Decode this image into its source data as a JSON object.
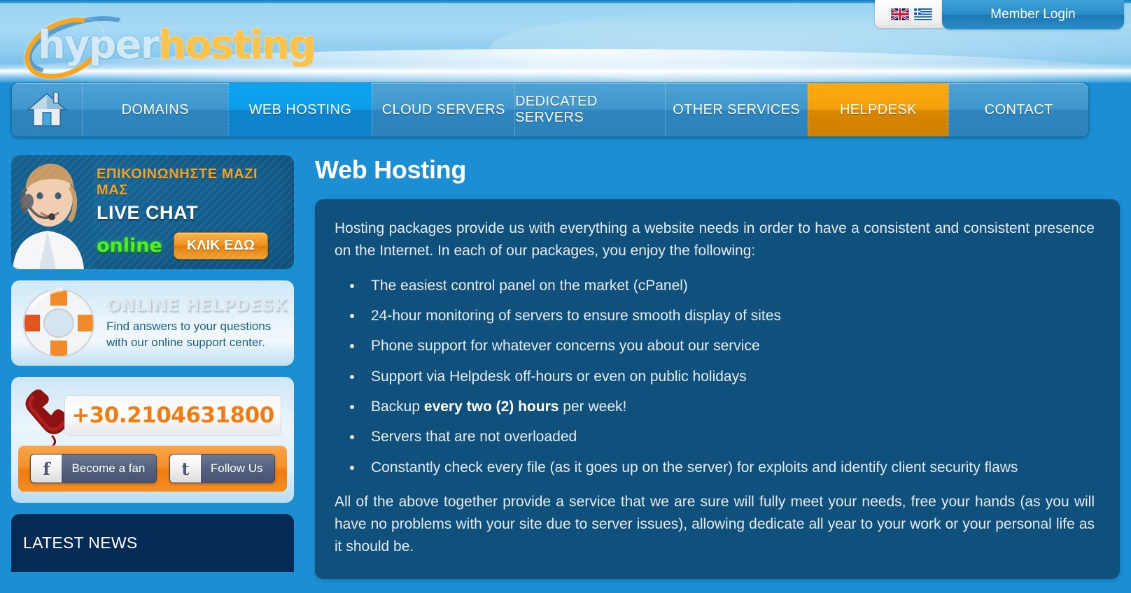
{
  "header": {
    "logo": {
      "part1": "hyper",
      "part2": "hosting"
    },
    "lang": {
      "flag_en_name": "uk-flag-icon",
      "flag_el_name": "greece-flag-icon"
    },
    "member_login": "Member Login"
  },
  "nav": {
    "home_icon": "home-icon",
    "items": [
      {
        "label": "DOMAINS",
        "state": "normal"
      },
      {
        "label": "WEB HOSTING",
        "state": "active-blue"
      },
      {
        "label": "CLOUD SERVERS",
        "state": "normal"
      },
      {
        "label": "DEDICATED SERVERS",
        "state": "normal"
      },
      {
        "label": "OTHER SERVICES",
        "state": "normal"
      },
      {
        "label": "HELPDESK",
        "state": "active-orange"
      },
      {
        "label": "CONTACT",
        "state": "normal"
      }
    ]
  },
  "sidebar": {
    "livechat": {
      "headline": "ΕΠΙΚΟΙΝΩΝΗΣΤΕ ΜΑΖΙ ΜΑΣ",
      "title": "LIVE CHAT",
      "status": "online",
      "button": "ΚΛΙΚ ΕΔΩ",
      "agent_icon": "support-agent-photo"
    },
    "helpdesk": {
      "title": "ONLINE HELPDESK",
      "description": "Find answers to your questions with our online support center.",
      "icon": "lifebuoy-icon"
    },
    "phone": {
      "number": "+30.2104631800",
      "icon": "phone-handset-icon",
      "facebook_label": "Become a fan",
      "facebook_glyph": "f",
      "twitter_label": "Follow Us",
      "twitter_glyph": "t"
    },
    "latest_news": {
      "title": "LATEST NEWS"
    }
  },
  "main": {
    "title": "Web Hosting",
    "intro": "Hosting packages provide us with everything a website needs in order to have a consistent and consistent presence on the Internet. In each of our packages, you enjoy the following:",
    "features": [
      {
        "text": "The easiest control panel on the market (cPanel)"
      },
      {
        "text": "24-hour monitoring of servers to ensure smooth display of sites"
      },
      {
        "text": "Phone support for whatever concerns you about our service"
      },
      {
        "text": "Support via Helpdesk off-hours or even on public holidays"
      },
      {
        "pre": "Backup ",
        "bold": "every two (2) hours",
        "post": " per week!"
      },
      {
        "text": "Servers that are not overloaded"
      },
      {
        "text": "Constantly check every file (as it goes up on the server) for exploits and identify client security flaws"
      }
    ],
    "outro": "All of the above together provide a service that we are sure will fully meet your needs, free your hands (as you will have no problems with your site due to server issues), allowing dedicate all year to your work or your personal life as it should be."
  },
  "colors": {
    "page_bg": "#1b8ed4",
    "panel_bg": "#10507d",
    "accent_orange": "#f5a00c",
    "accent_blue": "#0fa3f0",
    "news_bg": "#042b56"
  }
}
